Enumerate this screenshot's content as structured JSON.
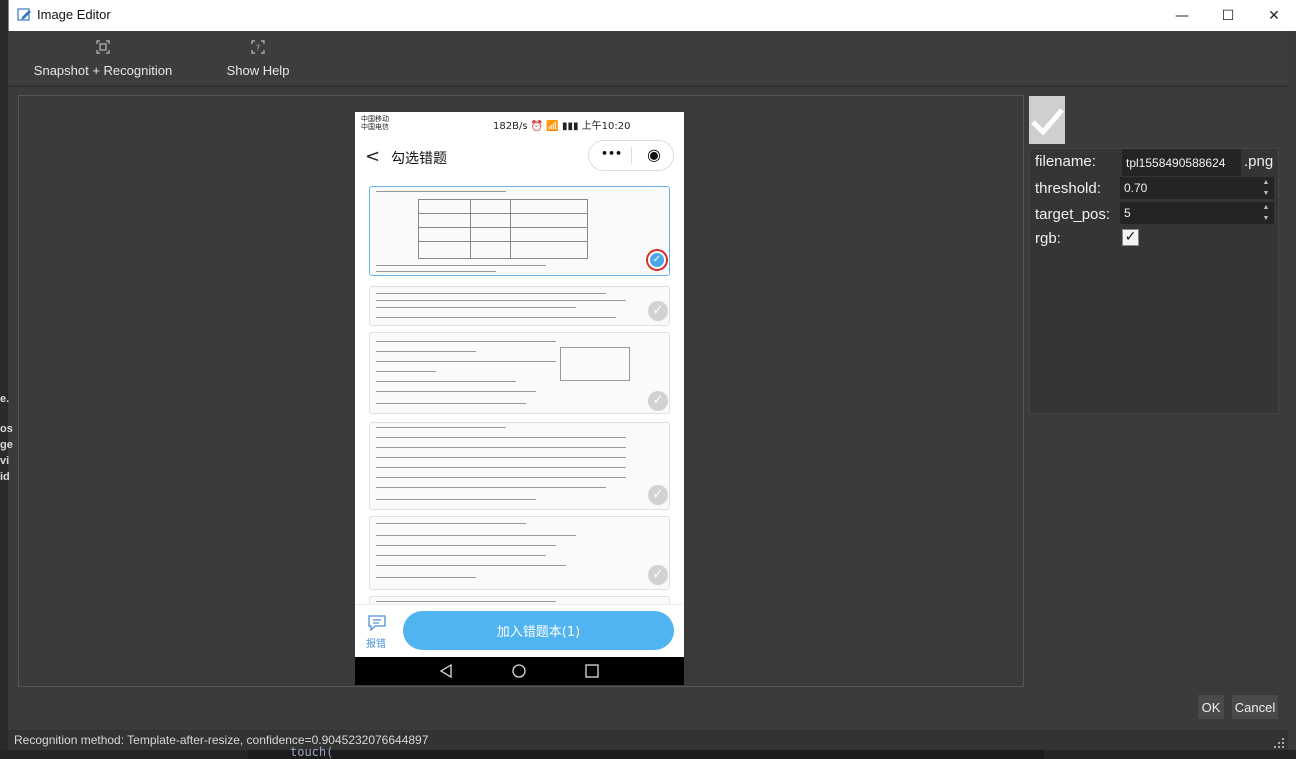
{
  "window": {
    "title": "Image Editor",
    "app_icon": "pencil-edit-icon",
    "controls": {
      "minimize": "—",
      "maximize": "☐",
      "close": "✕"
    }
  },
  "toolbar": {
    "snapshot_label": "Snapshot + Recognition",
    "snapshot_icon": "snapshot-icon",
    "help_label": "Show Help",
    "help_icon": "help-icon"
  },
  "phone": {
    "status_left": "中国移动 中国电信",
    "status_right": "182B/s ⏰ 📶 ▮▮▮ 上午10:20",
    "nav_title": "勾选错题",
    "nav_back": "<",
    "menu_dots": "•••",
    "target_icon": "◉",
    "report_label": "报错",
    "add_button": "加入错题本(1)"
  },
  "panel": {
    "filename_label": "filename:",
    "filename_value": "tpl1558490588624",
    "filename_ext": ".png",
    "threshold_label": "threshold:",
    "threshold_value": "0.70",
    "target_pos_label": "target_pos:",
    "target_pos_value": "5",
    "rgb_label": "rgb:",
    "rgb_checked": true
  },
  "buttons": {
    "ok": "OK",
    "cancel": "Cancel"
  },
  "status": {
    "message": "Recognition method: Template-after-resize, confidence=0.9045232076644897"
  },
  "background": {
    "code_fragment": "touch("
  },
  "colors": {
    "accent": "#4fb4f0",
    "panel_bg": "#353535",
    "window_bg": "#3b3b3b",
    "highlight_red": "#d93025"
  }
}
